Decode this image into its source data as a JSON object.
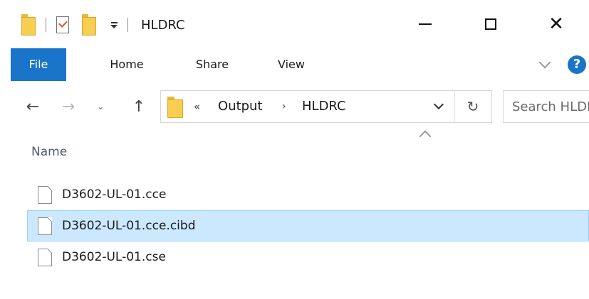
{
  "window": {
    "title": "HLDRC",
    "controls": {
      "minimize_icon": "minimize-icon",
      "maximize_icon": "maximize-icon",
      "close_icon": "close-icon"
    }
  },
  "ribbon": {
    "tabs": [
      {
        "label": "File",
        "active": true
      },
      {
        "label": "Home"
      },
      {
        "label": "Share"
      },
      {
        "label": "View"
      }
    ],
    "help_label": "?"
  },
  "nav": {
    "back_glyph": "←",
    "forward_glyph": "→",
    "recent_glyph": "⌄",
    "up_glyph": "↑"
  },
  "address": {
    "overflow_chevron": "«",
    "segments": [
      "Output",
      "HLDRC"
    ],
    "separator": "›",
    "refresh_glyph": "↻"
  },
  "search": {
    "placeholder": "Search HLDRC"
  },
  "columns": {
    "name": "Name"
  },
  "files": [
    {
      "name": "D3602-UL-01.cce",
      "selected": false
    },
    {
      "name": "D3602-UL-01.cce.cibd",
      "selected": true
    },
    {
      "name": "D3602-UL-01.cse",
      "selected": false
    }
  ],
  "colors": {
    "accent": "#1a74c9",
    "selection_bg": "#cce8ff",
    "selection_border": "#99d1ff",
    "folder": "#f7cd52"
  }
}
